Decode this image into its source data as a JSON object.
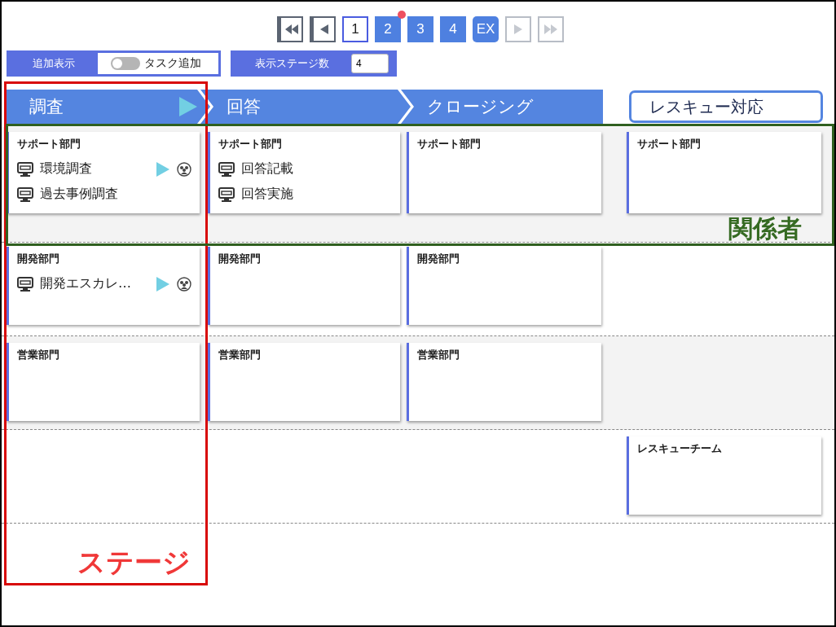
{
  "pager": [
    {
      "kind": "first",
      "disabled": false
    },
    {
      "kind": "prev",
      "disabled": false
    },
    {
      "kind": "page",
      "label": "1",
      "selected": true,
      "notify": false
    },
    {
      "kind": "page",
      "label": "2",
      "selected": false,
      "notify": true
    },
    {
      "kind": "page",
      "label": "3",
      "selected": false,
      "notify": false
    },
    {
      "kind": "page",
      "label": "4",
      "selected": false,
      "notify": false
    },
    {
      "kind": "ex",
      "label": "EX"
    },
    {
      "kind": "next",
      "disabled": true
    },
    {
      "kind": "last",
      "disabled": true
    }
  ],
  "controls": {
    "extra_label": "追加表示",
    "toggle": {
      "label": "タスク追加",
      "on": false
    },
    "stage_count_label": "表示ステージ数",
    "stage_count": "4"
  },
  "stages": [
    {
      "label": "調査",
      "current": true
    },
    {
      "label": "回答",
      "current": false
    },
    {
      "label": "クロージング",
      "current": false
    }
  ],
  "rescue_stage": "レスキュー対応",
  "rows": [
    {
      "cells": [
        {
          "title": "サポート部門",
          "tasks": [
            {
              "label": "環境調査",
              "running": true
            },
            {
              "label": "過去事例調査",
              "running": false
            }
          ]
        },
        {
          "title": "サポート部門",
          "tasks": [
            {
              "label": "回答記載",
              "running": false
            },
            {
              "label": "回答実施",
              "running": false
            }
          ]
        },
        {
          "title": "サポート部門"
        },
        {
          "title": "サポート部門"
        }
      ]
    },
    {
      "cells": [
        {
          "title": "開発部門",
          "tasks": [
            {
              "label": "開発エスカレ…",
              "running": true
            }
          ]
        },
        {
          "title": "開発部門"
        },
        {
          "title": "開発部門"
        },
        null
      ]
    },
    {
      "cells": [
        {
          "title": "営業部門"
        },
        {
          "title": "営業部門"
        },
        {
          "title": "営業部門"
        },
        null
      ]
    },
    {
      "cells": [
        null,
        null,
        null,
        {
          "title": "レスキューチーム"
        }
      ]
    }
  ],
  "annotations": {
    "stage_label": "ステージ",
    "stakeholder_label": "関係者"
  }
}
